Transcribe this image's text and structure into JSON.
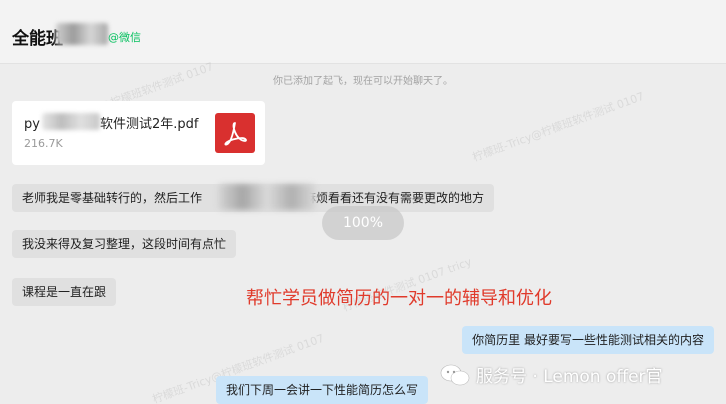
{
  "header": {
    "chat_title": "全能班",
    "wechat_tag": "@微信"
  },
  "system_message": "你已添加了起飞，现在可以开始聊天了。",
  "file": {
    "name_prefix": "py",
    "name_suffix": "软件测试2年.pdf",
    "size": "216.7K",
    "icon": "pdf-icon"
  },
  "messages": [
    {
      "side": "in",
      "text_before": "老师我是零基础转行的，然后工作",
      "text_after": "麻烦看看还有没有需要更改的地方"
    },
    {
      "side": "in",
      "text": "我没来得及复习整理，这段时间有点忙"
    },
    {
      "side": "in",
      "text": "课程是一直在跟"
    },
    {
      "side": "out",
      "text": "你简历里 最好要写一些性能测试相关的内容"
    },
    {
      "side": "out",
      "text": "我们下周一会讲一下性能简历怎么写"
    }
  ],
  "overlay_progress": "100%",
  "annotation": "帮忙学员做简历的一对一的辅导和优化",
  "footer_watermark": "服务号 · Lemon offer官",
  "watermarks": [
    "柠檬班-tricy@柠檬班软件测试 0107",
    "柠檬班-Tricy@柠檬班软件测试 0107",
    "柠檬班软件测试 0107 tricy",
    "柠檬班-Tricy@柠檬班软件测试 0107"
  ],
  "colors": {
    "background": "#ededed",
    "incoming_bubble": "#e0e0e0",
    "outgoing_bubble": "#c9e4f9",
    "annotation": "#e03a2b",
    "pdf_icon": "#d9302f",
    "wechat_green": "#07c160"
  }
}
